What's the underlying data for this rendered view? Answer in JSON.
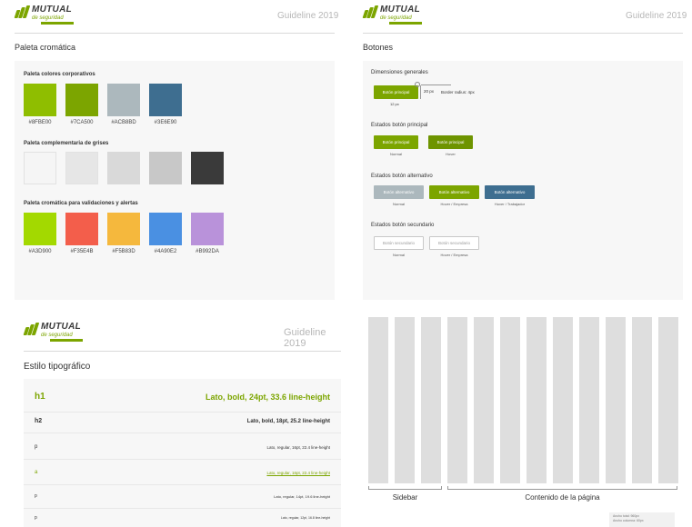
{
  "brand": {
    "logo_line1": "MUTUAL",
    "logo_line2": "de seguridad",
    "guideline": "Guideline 2019"
  },
  "palette": {
    "title": "Paleta cromática",
    "corporate_label": "Paleta colores corporativos",
    "corporate": [
      {
        "hex": "#8FBE00",
        "color": "#8FBE00"
      },
      {
        "hex": "#7CA500",
        "color": "#7CA500"
      },
      {
        "hex": "#ACB8BD",
        "color": "#ACB8BD"
      },
      {
        "hex": "#3E6E90",
        "color": "#3E6E90"
      }
    ],
    "greys_label": "Paleta complementaria de grises",
    "greys": [
      "#F5F5F5",
      "#E6E6E6",
      "#D9D9D9",
      "#C8C8C8",
      "#3A3A3A"
    ],
    "alerts_label": "Paleta cromática para validaciones y alertas",
    "alerts": [
      {
        "hex": "#A3D900",
        "color": "#A3D900"
      },
      {
        "hex": "#F35E4B",
        "color": "#F35E4B"
      },
      {
        "hex": "#F5B83D",
        "color": "#F5B83D"
      },
      {
        "hex": "#4A90E2",
        "color": "#4A90E2"
      },
      {
        "hex": "#B992DA",
        "color": "#B992DA"
      }
    ]
  },
  "buttons": {
    "title": "Botones",
    "dimensions_label": "Dimensiones generales",
    "sample_label": "Botón principal",
    "dim_height": "20 px",
    "dim_radius": "Border radius: 4px",
    "dim_padding": "12 px",
    "primary_label": "Estados botón principal",
    "primary": [
      {
        "label": "Botón principal",
        "caption": "Normal"
      },
      {
        "label": "Botón principal",
        "caption": "Hover"
      }
    ],
    "alt_label": "Estados botón alternativo",
    "alt": [
      {
        "label": "Botón alternativo",
        "caption": "Normal"
      },
      {
        "label": "Botón alternativo",
        "caption": "Hover / Empresa"
      },
      {
        "label": "Botón alternativo",
        "caption": "Hover / Trabajador"
      }
    ],
    "sec_label": "Estados botón secundario",
    "secondary": [
      {
        "label": "Botón secundario",
        "caption": "Normal"
      },
      {
        "label": "Botón secundario",
        "caption": "Hover / Empresa"
      }
    ]
  },
  "typography": {
    "title": "Estilo tipográfico",
    "rows": [
      {
        "tag": "h1",
        "spec": "Lato, bold, 24pt, 33.6 line-height"
      },
      {
        "tag": "h2",
        "spec": "Lato, bold, 18pt, 25.2 line-height"
      },
      {
        "tag": "p",
        "spec": "Lato, regular, 16pt, 22.4 line-height"
      },
      {
        "tag": "a",
        "spec": "Lato, regular, 16pt, 22.4 line-height"
      },
      {
        "tag": "p",
        "spec": "Lato, regular, 14pt, 19.6 line-height"
      },
      {
        "tag": "p",
        "spec": "Lato, regular, 12pt, 16.8 line-height"
      }
    ]
  },
  "grid": {
    "sidebar_label": "Sidebar",
    "content_label": "Contenido de la página",
    "note1": "Ancho total: 960px",
    "note2": "Ancho columna: 60px"
  }
}
